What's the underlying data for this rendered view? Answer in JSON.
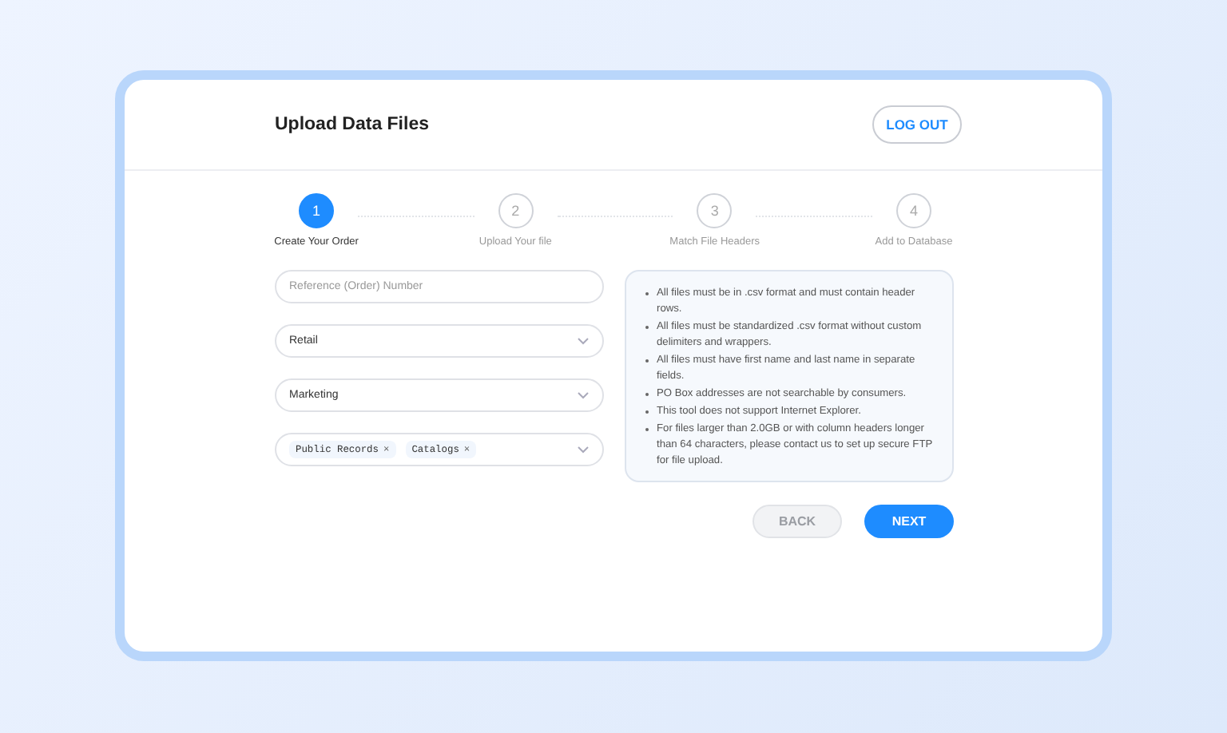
{
  "header": {
    "title": "Upload Data Files",
    "logout": "LOG OUT"
  },
  "steps": [
    {
      "number": "1",
      "label": "Create Your Order",
      "active": true
    },
    {
      "number": "2",
      "label": "Upload Your file",
      "active": false
    },
    {
      "number": "3",
      "label": "Match File Headers",
      "active": false
    },
    {
      "number": "4",
      "label": "Add to Database",
      "active": false
    }
  ],
  "form": {
    "reference": {
      "placeholder": "Reference (Order) Number"
    },
    "selects": [
      {
        "value": "Retail"
      },
      {
        "value": "Marketing"
      }
    ],
    "tags": [
      {
        "label": "Public Records",
        "remove": "×"
      },
      {
        "label": "Catalogs",
        "remove": "×"
      }
    ]
  },
  "info": [
    "All files must be in .csv format and must contain header rows.",
    "All files must be standardized .csv format without custom delimiters and wrappers.",
    "All files must have first name and last name in separate fields.",
    "PO Box addresses are not searchable by consumers.",
    "This tool does not support Internet Explorer.",
    "For files larger than 2.0GB or with column headers longer than 64 characters, please contact us to set up secure FTP for file upload."
  ],
  "buttons": [
    {
      "label": "BACK",
      "disabled": true
    },
    {
      "label": "NEXT",
      "disabled": false
    }
  ]
}
